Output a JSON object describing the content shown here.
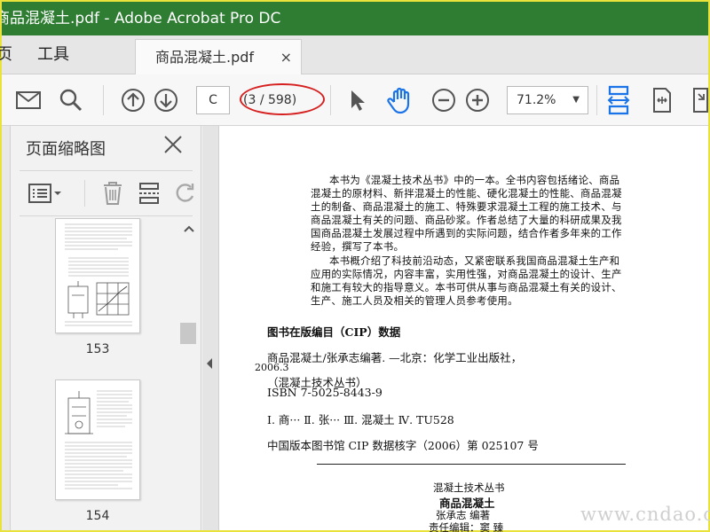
{
  "window": {
    "title": "商品混凝土.pdf - Adobe Acrobat Pro DC"
  },
  "tabs": {
    "home_partial": "页",
    "tools": "工具",
    "document": "商品混凝土.pdf",
    "close": "×"
  },
  "toolbar": {
    "page_input_value": "C",
    "page_count": "(3 / 598)",
    "zoom_value": "71.2%"
  },
  "sidebar": {
    "title": "页面缩略图",
    "thumbnails": [
      {
        "label": "153"
      },
      {
        "label": "154"
      }
    ]
  },
  "document": {
    "intro_lines": [
      "本书为《混凝土技术丛书》中的一本。全书内容包括绪论、商品",
      "混凝土的原材料、新拌混凝土的性能、硬化混凝土的性能、商品混凝",
      "土的制备、商品混凝土的施工、特殊要求混凝土工程的施工技术、与",
      "商品混凝土有关的问题、商品砂浆。作者总结了大量的科研成果及我",
      "国商品混凝土发展过程中所遇到的实际问题，结合作者多年来的工作",
      "经验，撰写了本书。"
    ],
    "intro2_lines": [
      "本书概介绍了科技前沿动态，又紧密联系我国商品混凝土生产和",
      "应用的实际情况，内容丰富，实用性强，对商品混凝土的设计、生产",
      "和施工有较大的指导意义。本书可供从事与商品混凝土有关的设计、",
      "生产、施工人员及相关的管理人员参考使用。"
    ],
    "cip_heading": "图书在版编目（CIP）数据",
    "cip_lines": [
      "商品混凝土/张承志编著. —北京：化学工业出版社，",
      "2006.3",
      "（混凝土技术丛书）",
      "ISBN 7-5025-8443-9"
    ],
    "classification": "Ⅰ. 商···  Ⅱ. 张···  Ⅲ. 混凝土  Ⅳ. TU528",
    "cip_number": "中国版本图书馆 CIP 数据核字（2006）第 025107 号",
    "series": "混凝土技术丛书",
    "book_title": "商品混凝土",
    "author": "张承志   编著",
    "editor": "责任编辑：窦   臻"
  },
  "watermark": "www.cndao.com"
}
